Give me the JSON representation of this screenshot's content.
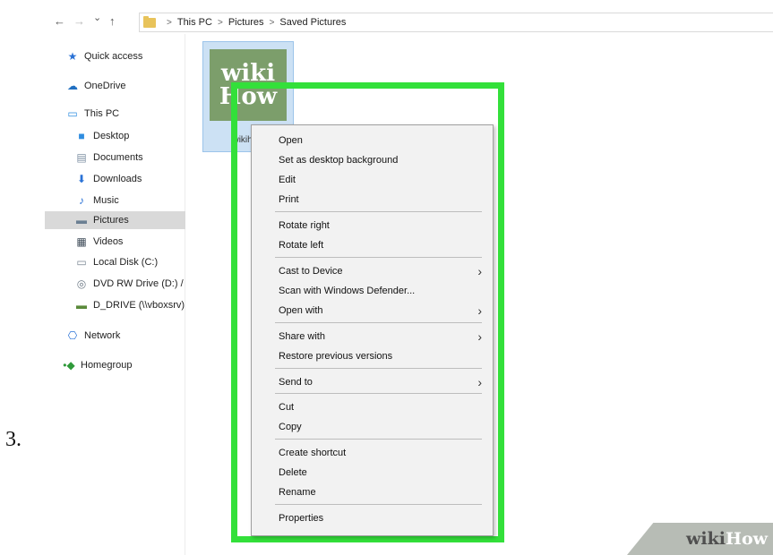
{
  "step_label": "3.",
  "address_bar": {
    "back_icon": "←",
    "forward_icon": "→",
    "dropdown_icon": "⌄",
    "up_icon": "↑",
    "breadcrumbs": [
      "This PC",
      "Pictures",
      "Saved Pictures"
    ]
  },
  "sidebar": {
    "items": [
      {
        "label": "Quick access",
        "icon": "star-icon",
        "glyph": "★",
        "color": "#2a72d6"
      },
      {
        "label": "OneDrive",
        "icon": "cloud-icon",
        "glyph": "☁",
        "color": "#1f6fc1"
      },
      {
        "label": "This PC",
        "icon": "computer-icon",
        "glyph": "▭",
        "color": "#2f8de0"
      },
      {
        "label": "Desktop",
        "icon": "desktop-icon",
        "glyph": "■",
        "color": "#2f8de0"
      },
      {
        "label": "Documents",
        "icon": "document-icon",
        "glyph": "▤",
        "color": "#7d8fa3"
      },
      {
        "label": "Downloads",
        "icon": "download-icon",
        "glyph": "⬇",
        "color": "#2a72d6"
      },
      {
        "label": "Music",
        "icon": "music-icon",
        "glyph": "♪",
        "color": "#2a72d6"
      },
      {
        "label": "Pictures",
        "icon": "pictures-icon",
        "glyph": "▬",
        "color": "#6b7f93"
      },
      {
        "label": "Videos",
        "icon": "video-icon",
        "glyph": "▦",
        "color": "#3e4b58"
      },
      {
        "label": "Local Disk (C:)",
        "icon": "disk-icon",
        "glyph": "▭",
        "color": "#7a8793"
      },
      {
        "label": "DVD RW Drive (D:) /",
        "icon": "dvd-icon",
        "glyph": "◎",
        "color": "#6d7a86"
      },
      {
        "label": "D_DRIVE (\\\\vboxsrv)",
        "icon": "network-drive-icon",
        "glyph": "▬",
        "color": "#5a8a3a"
      },
      {
        "label": "Network",
        "icon": "network-icon",
        "glyph": "⎔",
        "color": "#2a72d6"
      },
      {
        "label": "Homegroup",
        "icon": "homegroup-icon",
        "glyph": "•◆",
        "color": "#2f9a3a"
      }
    ]
  },
  "file": {
    "thumb_line1": "wiki",
    "thumb_line2": "How",
    "name": "wikihow"
  },
  "context_menu": {
    "groups": [
      [
        "Open",
        "Set as desktop background",
        "Edit",
        "Print"
      ],
      [
        "Rotate right",
        "Rotate left"
      ],
      [
        "Cast to Device",
        "Scan with Windows Defender...",
        "Open with"
      ],
      [
        "Share with",
        "Restore previous versions"
      ],
      [
        "Send to"
      ],
      [
        "Cut",
        "Copy"
      ],
      [
        "Create shortcut",
        "Delete",
        "Rename"
      ],
      [
        "Properties"
      ]
    ],
    "submenu_items": [
      "Cast to Device",
      "Open with",
      "Share with",
      "Send to"
    ],
    "submenu_glyph": "›",
    "highlight_color": "#33e03a"
  },
  "watermark": {
    "part1": "wiki",
    "part2": "How"
  }
}
